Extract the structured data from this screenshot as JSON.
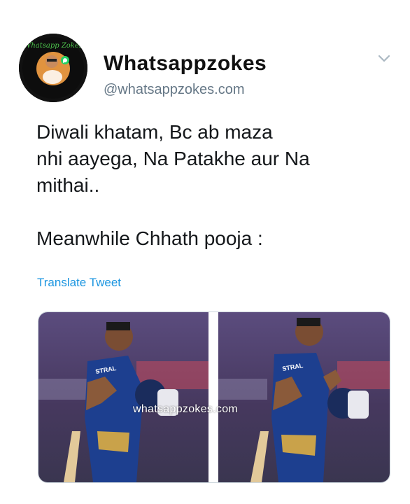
{
  "profile": {
    "display_name": "Whatsappzokes",
    "handle": "@whatsappzokes.com",
    "avatar_text": "Whatsapp Zokes"
  },
  "tweet": {
    "text": "Diwali khatam, Bc ab maza\nnhi aayega, Na Patakhe aur Na\nmithai..\n\nMeanwhile Chhath pooja :",
    "translate_label": "Translate Tweet"
  },
  "media": {
    "watermark": "whatsappzokes.com",
    "jersey_text": "STRAL"
  },
  "icons": {
    "menu": "chevron-down-icon"
  },
  "colors": {
    "link": "#1b95e0",
    "handle": "#657786",
    "jersey": "#1d3f8f",
    "background_purple": "#5a4a7a"
  }
}
